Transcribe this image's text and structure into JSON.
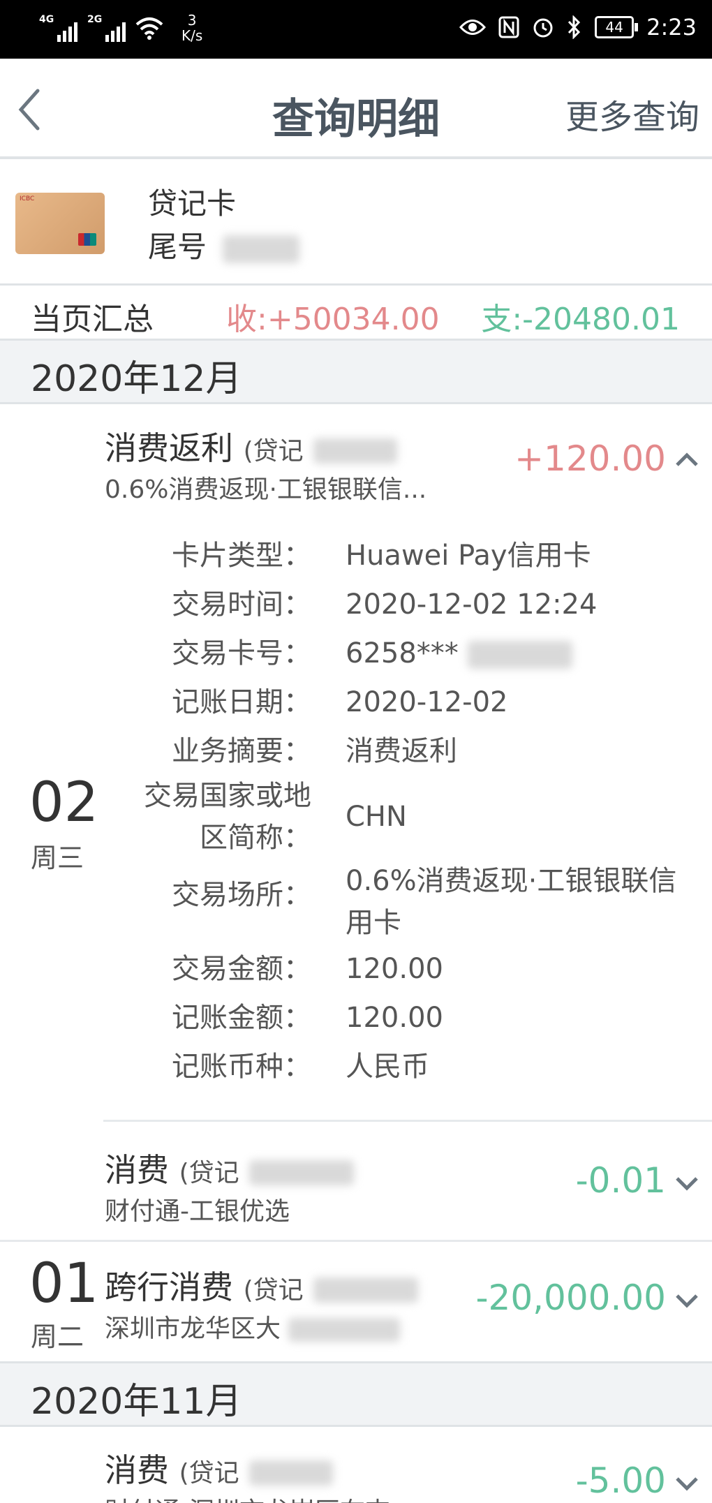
{
  "status_bar": {
    "net1": "4G",
    "net2": "2G",
    "speed_value": "3",
    "speed_unit": "K/s",
    "battery": "44",
    "time": "2:23"
  },
  "header": {
    "title": "查询明细",
    "more": "更多查询"
  },
  "card": {
    "name": "贷记卡",
    "tail_label": "尾号"
  },
  "summary": {
    "label": "当页汇总",
    "income": "收:+50034.00",
    "expense": "支:-20480.01"
  },
  "months": [
    {
      "label": "2020年12月"
    },
    {
      "label": "2020年11月"
    }
  ],
  "transactions": [
    {
      "title": "消费返利",
      "paren": "(贷记",
      "subtitle": "0.6%消费返现·工银银联信...",
      "amount": "+120.00",
      "expanded": true
    },
    {
      "title": "消费",
      "paren": "(贷记",
      "subtitle": "财付通-工银优选",
      "amount": "-0.01",
      "expanded": false
    },
    {
      "title": "跨行消费",
      "paren": "(贷记",
      "subtitle": "深圳市龙华区大",
      "amount": "-20,000.00",
      "expanded": false
    },
    {
      "title": "消费",
      "paren": "(贷记",
      "subtitle": "财付通-深圳市龙岗区布吉",
      "amount": "-5.00",
      "expanded": false
    }
  ],
  "days": [
    {
      "num": "02",
      "week": "周三"
    },
    {
      "num": "01",
      "week": "周二"
    }
  ],
  "details": [
    {
      "label": "卡片类型：",
      "value": "Huawei Pay信用卡"
    },
    {
      "label": "交易时间：",
      "value": "2020-12-02 12:24"
    },
    {
      "label": "交易卡号：",
      "value": "6258***"
    },
    {
      "label": "记账日期：",
      "value": "2020-12-02"
    },
    {
      "label": "业务摘要：",
      "value": "消费返利"
    },
    {
      "label": "交易国家或地区简称：",
      "value": "CHN"
    },
    {
      "label": "交易场所：",
      "value": "0.6%消费返现·工银银联信用卡"
    },
    {
      "label": "交易金额：",
      "value": "120.00"
    },
    {
      "label": "记账金额：",
      "value": "120.00"
    },
    {
      "label": "记账币种：",
      "value": "人民币"
    }
  ],
  "colors": {
    "income": "#e3898b",
    "expense": "#62c19c",
    "title": "#4a5560"
  }
}
